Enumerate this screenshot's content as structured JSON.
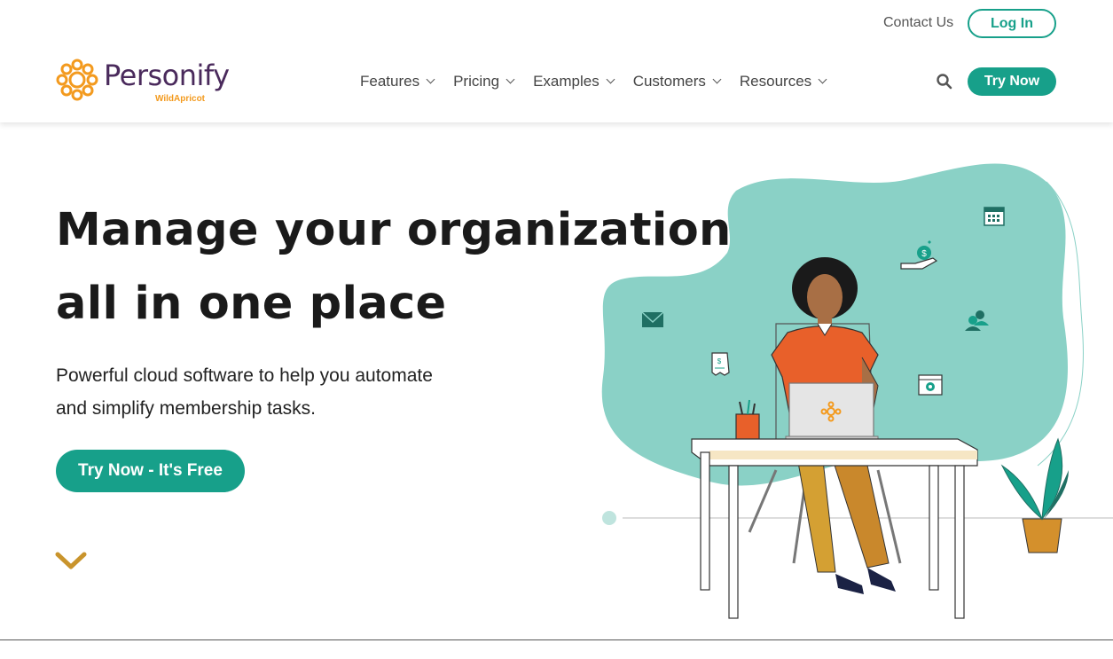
{
  "header": {
    "contact_label": "Contact Us",
    "login_label": "Log In",
    "logo": {
      "name": "Personify",
      "sub": "WildApricot"
    },
    "nav": [
      {
        "label": "Features"
      },
      {
        "label": "Pricing"
      },
      {
        "label": "Examples"
      },
      {
        "label": "Customers"
      },
      {
        "label": "Resources"
      }
    ],
    "search_icon": "search-icon",
    "try_label": "Try Now"
  },
  "hero": {
    "title_line1": "Manage your organization",
    "title_line2": "all in one place",
    "subtitle_line1": "Powerful cloud software to help you automate",
    "subtitle_line2": "and simplify membership tasks.",
    "cta_label": "Try Now - It's Free",
    "scroll_icon": "chevron-down-icon"
  },
  "colors": {
    "accent": "#17a08a",
    "brand_purple": "#4a2a5c",
    "brand_orange": "#f39a1e",
    "blob": "#8ad1c6",
    "shirt": "#e8602a",
    "pants": "#d4a033"
  }
}
